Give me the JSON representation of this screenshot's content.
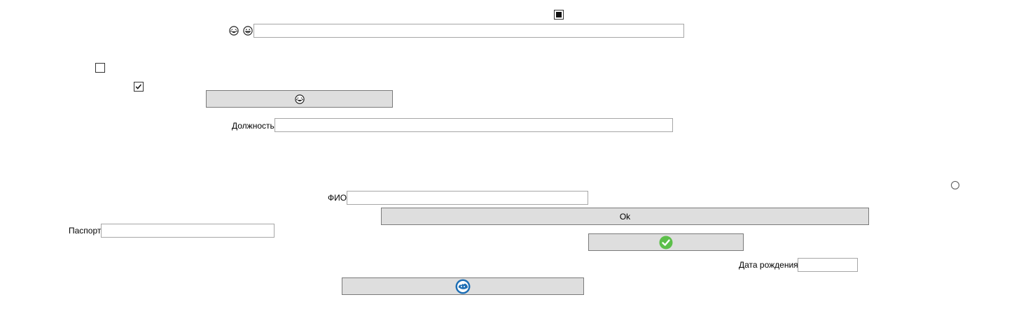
{
  "fields": {
    "position_label": "Должность",
    "position_value": "",
    "fio_label": "ФИО",
    "fio_value": "",
    "passport_label": "Паспорт",
    "passport_value": "",
    "birth_date_label": "Дата рождения",
    "birth_date_value": "",
    "top_input_value": ""
  },
  "buttons": {
    "ok_label": "Ok",
    "emoji_button_icon": "laughing-face-icon",
    "confirm_button_icon": "green-check-icon",
    "blue_button_icon": "blue-round-icon"
  },
  "controls": {
    "top_checkbox_state": "indeterminate",
    "checkbox_1_checked": false,
    "checkbox_2_checked": true,
    "radio_checked": false
  },
  "icons": {
    "top_emoji_1": "laughing-face-icon",
    "top_emoji_2": "grinning-face-icon"
  },
  "colors": {
    "button_bg": "#dedede",
    "input_border": "#a6a6a6",
    "check_green": "#5cbf4a",
    "blue_icon": "#1e6fb5"
  }
}
